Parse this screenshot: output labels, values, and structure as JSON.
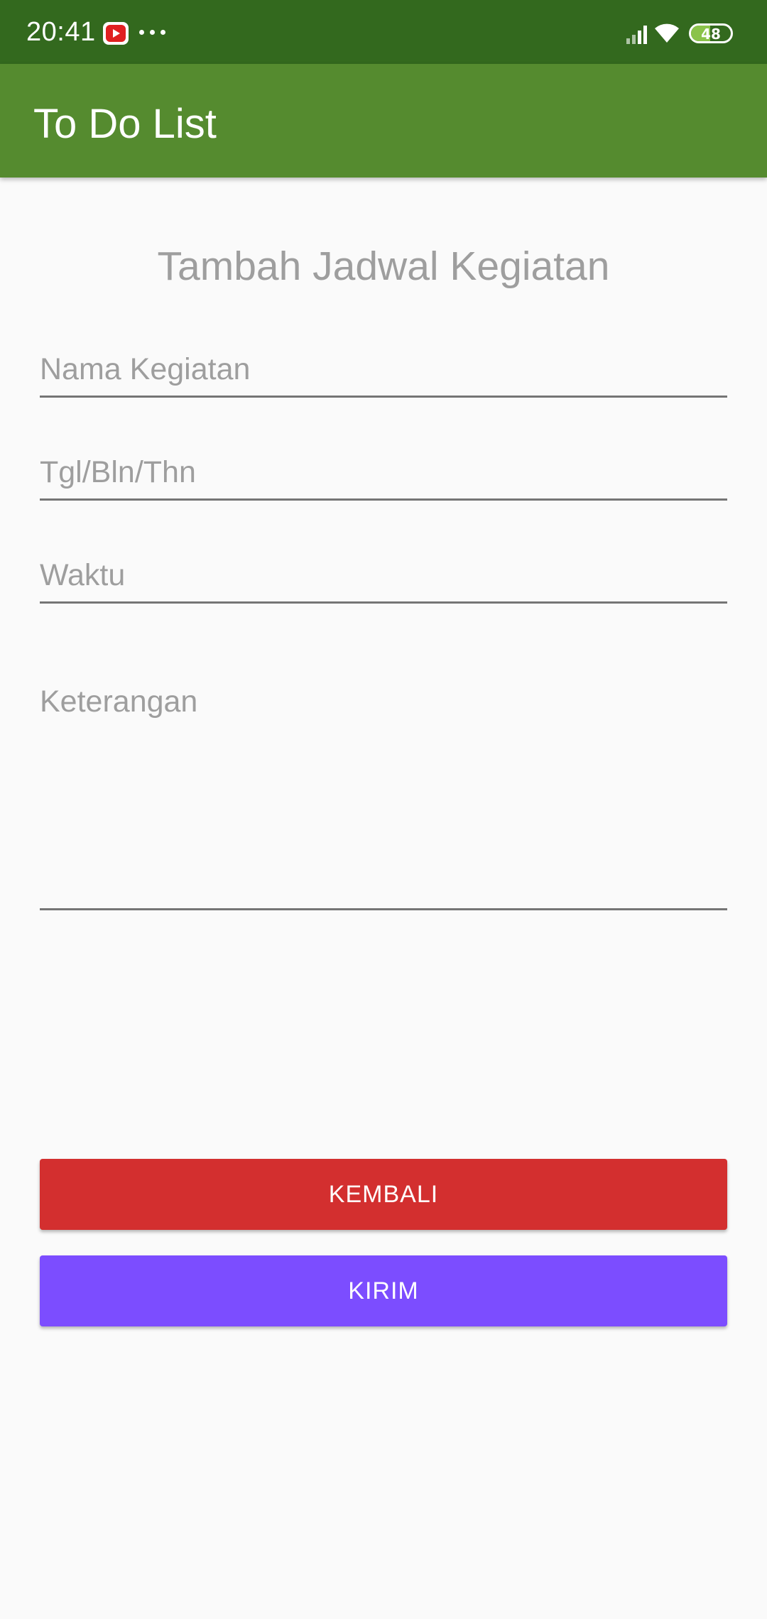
{
  "status_bar": {
    "time": "20:41",
    "battery_level": "48",
    "battery_fraction": 0.48,
    "icons": [
      "youtube-icon",
      "more-dots-icon",
      "signal-icon",
      "wifi-icon",
      "battery-icon"
    ]
  },
  "app_bar": {
    "title": "To Do List"
  },
  "form": {
    "heading": "Tambah Jadwal Kegiatan",
    "nama_placeholder": "Nama Kegiatan",
    "tgl_placeholder": "Tgl/Bln/Thn",
    "waktu_placeholder": "Waktu",
    "keterangan_placeholder": "Keterangan"
  },
  "buttons": {
    "back_label": "KEMBALI",
    "send_label": "KIRIM"
  },
  "colors": {
    "status_bar": "#33691e",
    "app_bar": "#558b2f",
    "back_button": "#d32f2f",
    "send_button": "#7c4dff",
    "battery_fill": "#8bc34a"
  }
}
